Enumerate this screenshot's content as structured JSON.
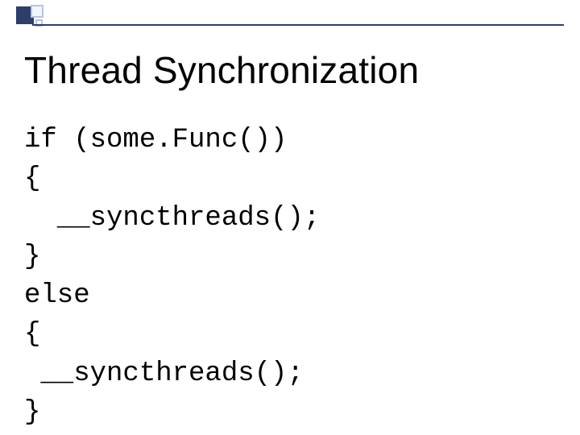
{
  "title": "Thread Synchronization",
  "code": {
    "line1": "if (some.Func())",
    "line2": "{",
    "line3": "  __syncthreads();",
    "line4": "}",
    "line5": "else",
    "line6": "{",
    "line7": " __syncthreads();",
    "line8": "}"
  }
}
